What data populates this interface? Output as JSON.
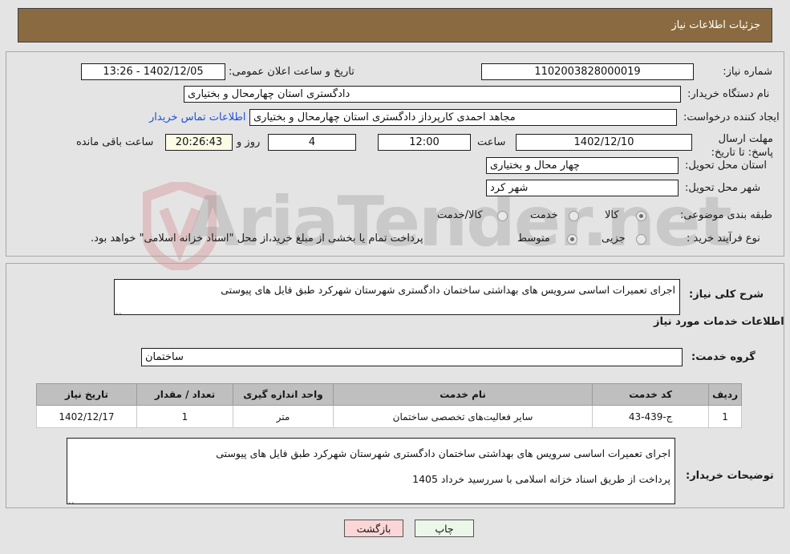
{
  "header": {
    "title": "جزئیات اطلاعات نیاز"
  },
  "watermark": {
    "text": "AriaTender.net"
  },
  "summary": {
    "need_number_label": "شماره نیاز:",
    "need_number_value": "1102003828000019",
    "buyer_org_label": "نام دستگاه خریدار:",
    "buyer_org_value": "دادگستری استان چهارمحال و بختیاری",
    "creator_label": "ایجاد کننده درخواست:",
    "creator_value": "مجاهد احمدی کارپرداز دادگستری استان چهارمحال و بختیاری",
    "contact_link": "اطلاعات تماس خریدار",
    "deadline_label": "مهلت ارسال پاسخ: تا تاریخ:",
    "deadline_date": "1402/12/10",
    "deadline_time_label": "ساعت",
    "deadline_time": "12:00",
    "remaining_days": "4",
    "remaining_days_unit": "روز و",
    "remaining_clock": "20:26:43",
    "remaining_suffix": "ساعت باقی مانده",
    "announce_label": "تاریخ و ساعت اعلان عمومی:",
    "announce_value": "13:26 - 1402/12/05",
    "province_label": "استان محل تحویل:",
    "province_value": "چهار محال و بختیاری",
    "city_label": "شهر محل تحویل:",
    "city_value": "شهر کرد",
    "category_label": "طبقه بندی موضوعی:",
    "category_options": [
      {
        "label": "کالا",
        "selected": true
      },
      {
        "label": "خدمت",
        "selected": false
      },
      {
        "label": "کالا/خدمت",
        "selected": false
      }
    ],
    "process_label": "نوع فرآیند خرید :",
    "process_options": [
      {
        "label": "جزیی",
        "selected": false
      },
      {
        "label": "متوسط",
        "selected": true
      }
    ],
    "payment_note": "پرداخت تمام یا بخشی از مبلغ خرید،از محل \"اسناد خزانه اسلامی\" خواهد بود."
  },
  "details": {
    "general_desc_label": "شرح کلی نیاز:",
    "general_desc_value": "اجرای تعمیرات اساسی سرویس های بهداشتی ساختمان دادگستری شهرستان شهرکرد طبق فایل های پیوستی",
    "services_heading": "اطلاعات خدمات مورد نیاز",
    "service_group_label": "گروه خدمت:",
    "service_group_value": "ساختمان",
    "table": {
      "columns": [
        "ردیف",
        "کد خدمت",
        "نام خدمت",
        "واحد اندازه گیری",
        "تعداد / مقدار",
        "تاریخ نیاز"
      ],
      "rows": [
        {
          "row_no": "1",
          "service_code": "ج-439-43",
          "service_name": "سایر فعالیت‌های تخصصی ساختمان",
          "unit": "متر",
          "quantity": "1",
          "need_date": "1402/12/17"
        }
      ]
    },
    "buyer_notes_label": "توضیحات خریدار:",
    "buyer_notes_line1": "اجرای تعمیرات اساسی سرویس های بهداشتی ساختمان دادگستری شهرستان شهرکرد طبق فایل های پیوستی",
    "buyer_notes_line2": "پرداخت از طریق اسناد خزانه اسلامی با سررسید خرداد 1405"
  },
  "footer": {
    "print_label": "چاپ",
    "back_label": "بازگشت"
  }
}
